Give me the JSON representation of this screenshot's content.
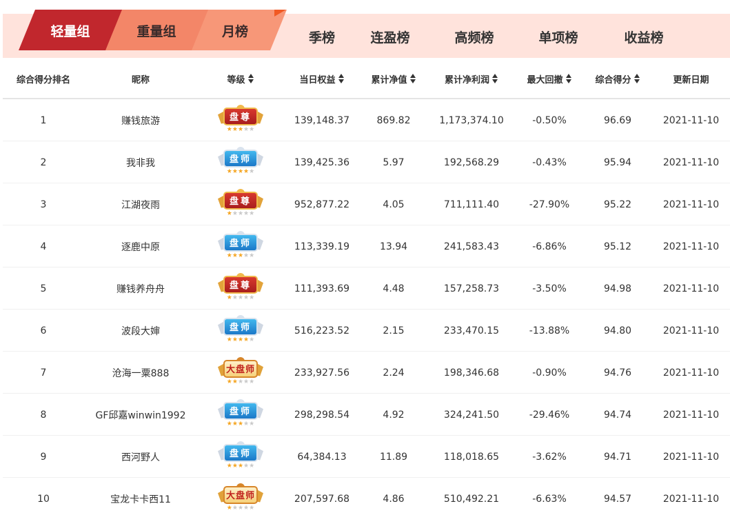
{
  "tabs": [
    {
      "label": "轻量组",
      "active": true
    },
    {
      "label": "重量组",
      "active": false
    },
    {
      "label": "月榜",
      "active": false
    },
    {
      "label": "季榜",
      "active": false
    },
    {
      "label": "连盈榜",
      "active": false
    },
    {
      "label": "高频榜",
      "active": false
    },
    {
      "label": "单项榜",
      "active": false
    },
    {
      "label": "收益榜",
      "active": false
    }
  ],
  "columns": [
    {
      "label": "综合得分排名",
      "sortable": false
    },
    {
      "label": "昵称",
      "sortable": false
    },
    {
      "label": "等级",
      "sortable": true
    },
    {
      "label": "当日权益",
      "sortable": true
    },
    {
      "label": "累计净值",
      "sortable": true
    },
    {
      "label": "累计净利润",
      "sortable": true
    },
    {
      "label": "最大回撤",
      "sortable": true
    },
    {
      "label": "综合得分",
      "sortable": true
    },
    {
      "label": "更新日期",
      "sortable": false
    }
  ],
  "rows": [
    {
      "rank": "1",
      "nickname": "赚钱旅游",
      "badge": {
        "type": "red",
        "text": "盘尊",
        "stars": 3
      },
      "equity": "139,148.37",
      "nav": "869.82",
      "profit": "1,173,374.10",
      "drawdown": "-0.50%",
      "score": "96.69",
      "date": "2021-11-10"
    },
    {
      "rank": "2",
      "nickname": "我非我",
      "badge": {
        "type": "blue",
        "text": "盘师",
        "stars": 4
      },
      "equity": "139,425.36",
      "nav": "5.97",
      "profit": "192,568.29",
      "drawdown": "-0.43%",
      "score": "95.94",
      "date": "2021-11-10"
    },
    {
      "rank": "3",
      "nickname": "江湖夜雨",
      "badge": {
        "type": "red",
        "text": "盘尊",
        "stars": 1
      },
      "equity": "952,877.22",
      "nav": "4.05",
      "profit": "711,111.40",
      "drawdown": "-27.90%",
      "score": "95.22",
      "date": "2021-11-10"
    },
    {
      "rank": "4",
      "nickname": "逐鹿中原",
      "badge": {
        "type": "blue",
        "text": "盘师",
        "stars": 3
      },
      "equity": "113,339.19",
      "nav": "13.94",
      "profit": "241,583.43",
      "drawdown": "-6.86%",
      "score": "95.12",
      "date": "2021-11-10"
    },
    {
      "rank": "5",
      "nickname": "赚钱养舟舟",
      "badge": {
        "type": "red",
        "text": "盘尊",
        "stars": 1
      },
      "equity": "111,393.69",
      "nav": "4.48",
      "profit": "157,258.73",
      "drawdown": "-3.50%",
      "score": "94.98",
      "date": "2021-11-10"
    },
    {
      "rank": "6",
      "nickname": "波段大婶",
      "badge": {
        "type": "blue",
        "text": "盘师",
        "stars": 4
      },
      "equity": "516,223.52",
      "nav": "2.15",
      "profit": "233,470.15",
      "drawdown": "-13.88%",
      "score": "94.80",
      "date": "2021-11-10"
    },
    {
      "rank": "7",
      "nickname": "沧海一粟888",
      "badge": {
        "type": "gold",
        "text": "大盘师",
        "stars": 2
      },
      "equity": "233,927.56",
      "nav": "2.24",
      "profit": "198,346.68",
      "drawdown": "-0.90%",
      "score": "94.76",
      "date": "2021-11-10"
    },
    {
      "rank": "8",
      "nickname": "GF邱嘉winwin1992",
      "badge": {
        "type": "blue",
        "text": "盘师",
        "stars": 3
      },
      "equity": "298,298.54",
      "nav": "4.92",
      "profit": "324,241.50",
      "drawdown": "-29.46%",
      "score": "94.74",
      "date": "2021-11-10"
    },
    {
      "rank": "9",
      "nickname": "西河野人",
      "badge": {
        "type": "blue",
        "text": "盘师",
        "stars": 3
      },
      "equity": "64,384.13",
      "nav": "11.89",
      "profit": "118,018.65",
      "drawdown": "-3.62%",
      "score": "94.71",
      "date": "2021-11-10"
    },
    {
      "rank": "10",
      "nickname": "宝龙卡卡西11",
      "badge": {
        "type": "gold",
        "text": "大盘师",
        "stars": 1
      },
      "equity": "207,597.68",
      "nav": "4.86",
      "profit": "510,492.21",
      "drawdown": "-6.63%",
      "score": "94.57",
      "date": "2021-11-10"
    }
  ],
  "colors": {
    "active_tab": "#c1272d",
    "tab_bar_bg": "#ffe3dc",
    "badge_red": "#c1272d",
    "badge_blue": "#2a8fd8",
    "badge_gold": "#f6d17a",
    "star_on": "#f5a623"
  }
}
